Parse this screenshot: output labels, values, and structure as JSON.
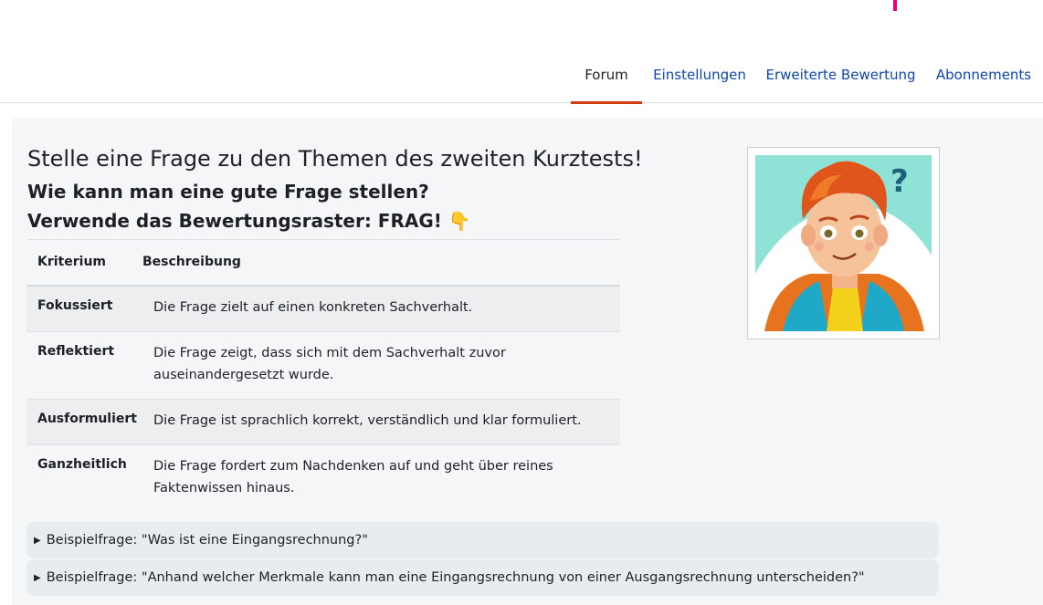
{
  "accent_color": "#e6007e",
  "nav": {
    "tabs": [
      {
        "label": "Forum",
        "active": true
      },
      {
        "label": "Einstellungen",
        "active": false
      },
      {
        "label": "Erweiterte Bewertung",
        "active": false
      },
      {
        "label": "Abonnements",
        "active": false
      }
    ],
    "active_color": "#d03d0e",
    "link_color": "#0f47ad"
  },
  "intro": {
    "title": "Stelle eine Frage zu den Themen des zweiten Kurztests!",
    "subtitle": "Wie kann man eine gute Frage stellen?",
    "rubric_line": "Verwende das Bewertungsraster: FRAG!",
    "rubric_emoji": "👇"
  },
  "rubric": {
    "headers": [
      "Kriterium",
      "Beschreibung"
    ],
    "rows": [
      {
        "criterion": "Fokussiert",
        "description": "Die Frage zielt auf einen konkreten Sachverhalt."
      },
      {
        "criterion": "Reflektiert",
        "description": "Die Frage zeigt, dass sich mit dem Sachverhalt zuvor auseinandergesetzt wurde."
      },
      {
        "criterion": "Ausformuliert",
        "description": "Die Frage ist sprachlich korrekt, verständlich und klar formuliert."
      },
      {
        "criterion": "Ganzheitlich",
        "description": "Die Frage fordert zum Nachdenken auf und geht über reines Faktenwissen hinaus."
      }
    ]
  },
  "illustration": {
    "icon": "thinking-boy-illustration",
    "question_mark": "?"
  },
  "examples": [
    {
      "label": "Beispielfrage: \"Was ist eine Eingangsrechnung?\"",
      "expanded": false
    },
    {
      "label": "Beispielfrage: \"Anhand welcher Merkmale kann man eine Eingangsrechnung von einer Ausgangsrechnung unterscheiden?\"",
      "expanded": false
    }
  ]
}
